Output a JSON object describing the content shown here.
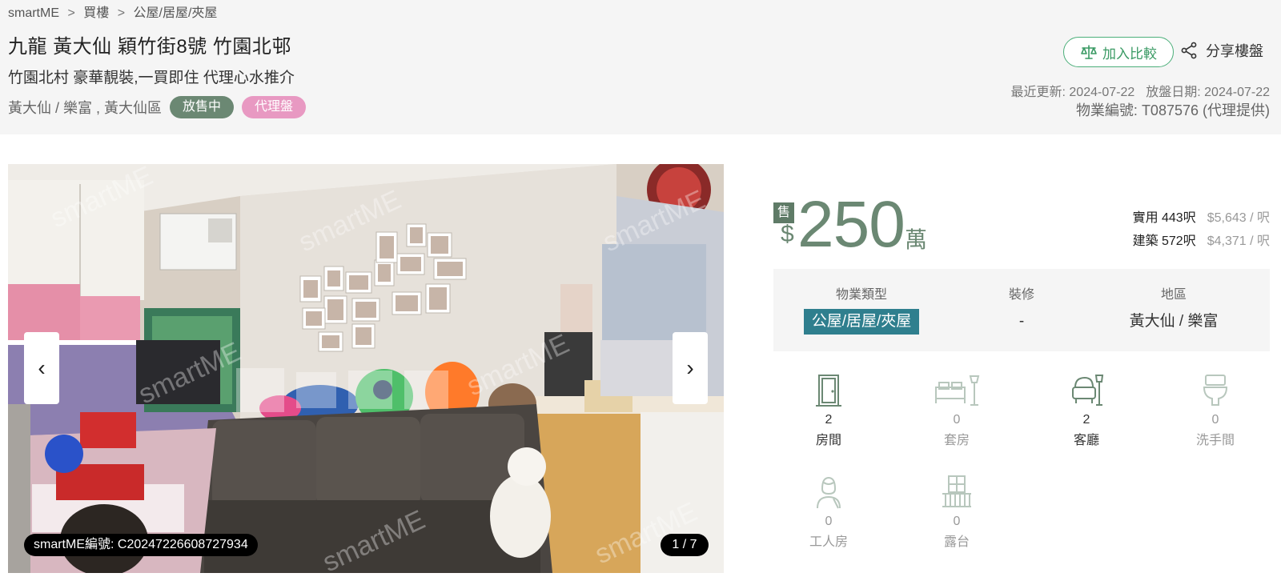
{
  "breadcrumb": [
    "smartME",
    "買樓",
    "公屋/居屋/夾屋"
  ],
  "breadcrumb_sep": ">",
  "listing": {
    "title": "九龍 黃大仙 穎竹街8號 竹園北邨",
    "subtitle": "竹園北村 豪華靚裝,一買即住 代理心水推介",
    "location": "黃大仙 / 樂富 , 黃大仙區",
    "status_badge": "放售中",
    "agent_badge": "代理盤"
  },
  "actions": {
    "compare_label": "加入比較",
    "share_label": "分享樓盤"
  },
  "meta": {
    "updated": "最近更新: 2024-07-22",
    "listed": "放盤日期: 2024-07-22",
    "property_no": "物業編號: T087576 (代理提供)"
  },
  "gallery": {
    "image_id": "smartME編號: C20247226608727934",
    "counter": "1 / 7",
    "prev": "‹",
    "next": "›",
    "watermark": "smartME"
  },
  "price": {
    "tag": "售",
    "currency": "$",
    "amount": "250",
    "unit": "萬"
  },
  "area": {
    "saleable_label": "實用 443呎",
    "saleable_ppf": "$5,643 / 呎",
    "gross_label": "建築 572呎",
    "gross_ppf": "$4,371 / 呎"
  },
  "summary": {
    "type_label": "物業類型",
    "type_value": "公屋/居屋/夾屋",
    "reno_label": "裝修",
    "reno_value": "-",
    "district_label": "地區",
    "district_value": "黃大仙 / 樂富"
  },
  "features": [
    {
      "icon": "door-icon",
      "count": "2",
      "label": "房間",
      "active": true
    },
    {
      "icon": "bed-icon",
      "count": "0",
      "label": "套房",
      "active": false
    },
    {
      "icon": "armchair-icon",
      "count": "2",
      "label": "客廳",
      "active": true
    },
    {
      "icon": "toilet-icon",
      "count": "0",
      "label": "洗手間",
      "active": false
    },
    {
      "icon": "maid-icon",
      "count": "0",
      "label": "工人房",
      "active": false
    },
    {
      "icon": "balcony-icon",
      "count": "0",
      "label": "露台",
      "active": false
    }
  ],
  "colors": {
    "accent_green": "#6b8873",
    "badge_pink": "#e899c2",
    "type_teal": "#2f7f8e",
    "compare_green": "#3a9a64"
  }
}
